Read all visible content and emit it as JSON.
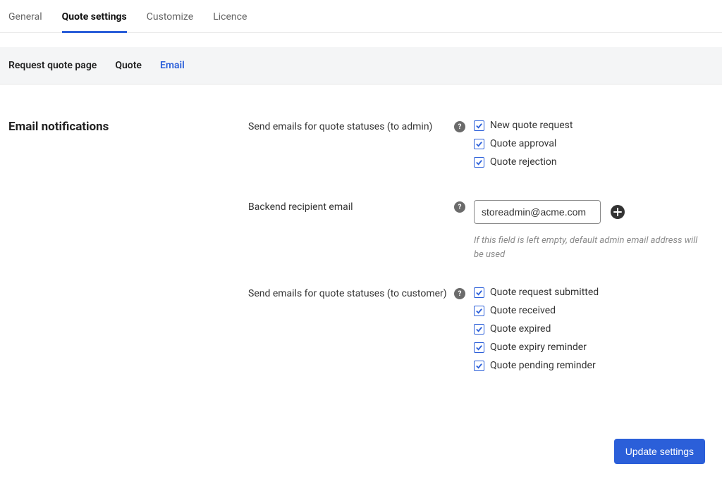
{
  "tabs": {
    "primary": [
      {
        "label": "General",
        "active": false
      },
      {
        "label": "Quote settings",
        "active": true
      },
      {
        "label": "Customize",
        "active": false
      },
      {
        "label": "Licence",
        "active": false
      }
    ],
    "secondary": [
      {
        "label": "Request quote page",
        "active": false
      },
      {
        "label": "Quote",
        "active": false
      },
      {
        "label": "Email",
        "active": true
      }
    ]
  },
  "section": {
    "title": "Email notifications"
  },
  "fields": {
    "admin_statuses": {
      "label": "Send emails for quote statuses (to admin)",
      "options": [
        {
          "label": "New quote request",
          "checked": true
        },
        {
          "label": "Quote approval",
          "checked": true
        },
        {
          "label": "Quote rejection",
          "checked": true
        }
      ]
    },
    "recipient_email": {
      "label": "Backend recipient email",
      "value": "storeadmin@acme.com",
      "hint": "If this field is left empty, default admin email address will be used"
    },
    "customer_statuses": {
      "label": "Send emails for quote statuses (to customer)",
      "options": [
        {
          "label": "Quote request submitted",
          "checked": true
        },
        {
          "label": "Quote received",
          "checked": true
        },
        {
          "label": "Quote expired",
          "checked": true
        },
        {
          "label": "Quote expiry reminder",
          "checked": true
        },
        {
          "label": "Quote pending reminder",
          "checked": true
        }
      ]
    }
  },
  "buttons": {
    "save": "Update settings"
  }
}
